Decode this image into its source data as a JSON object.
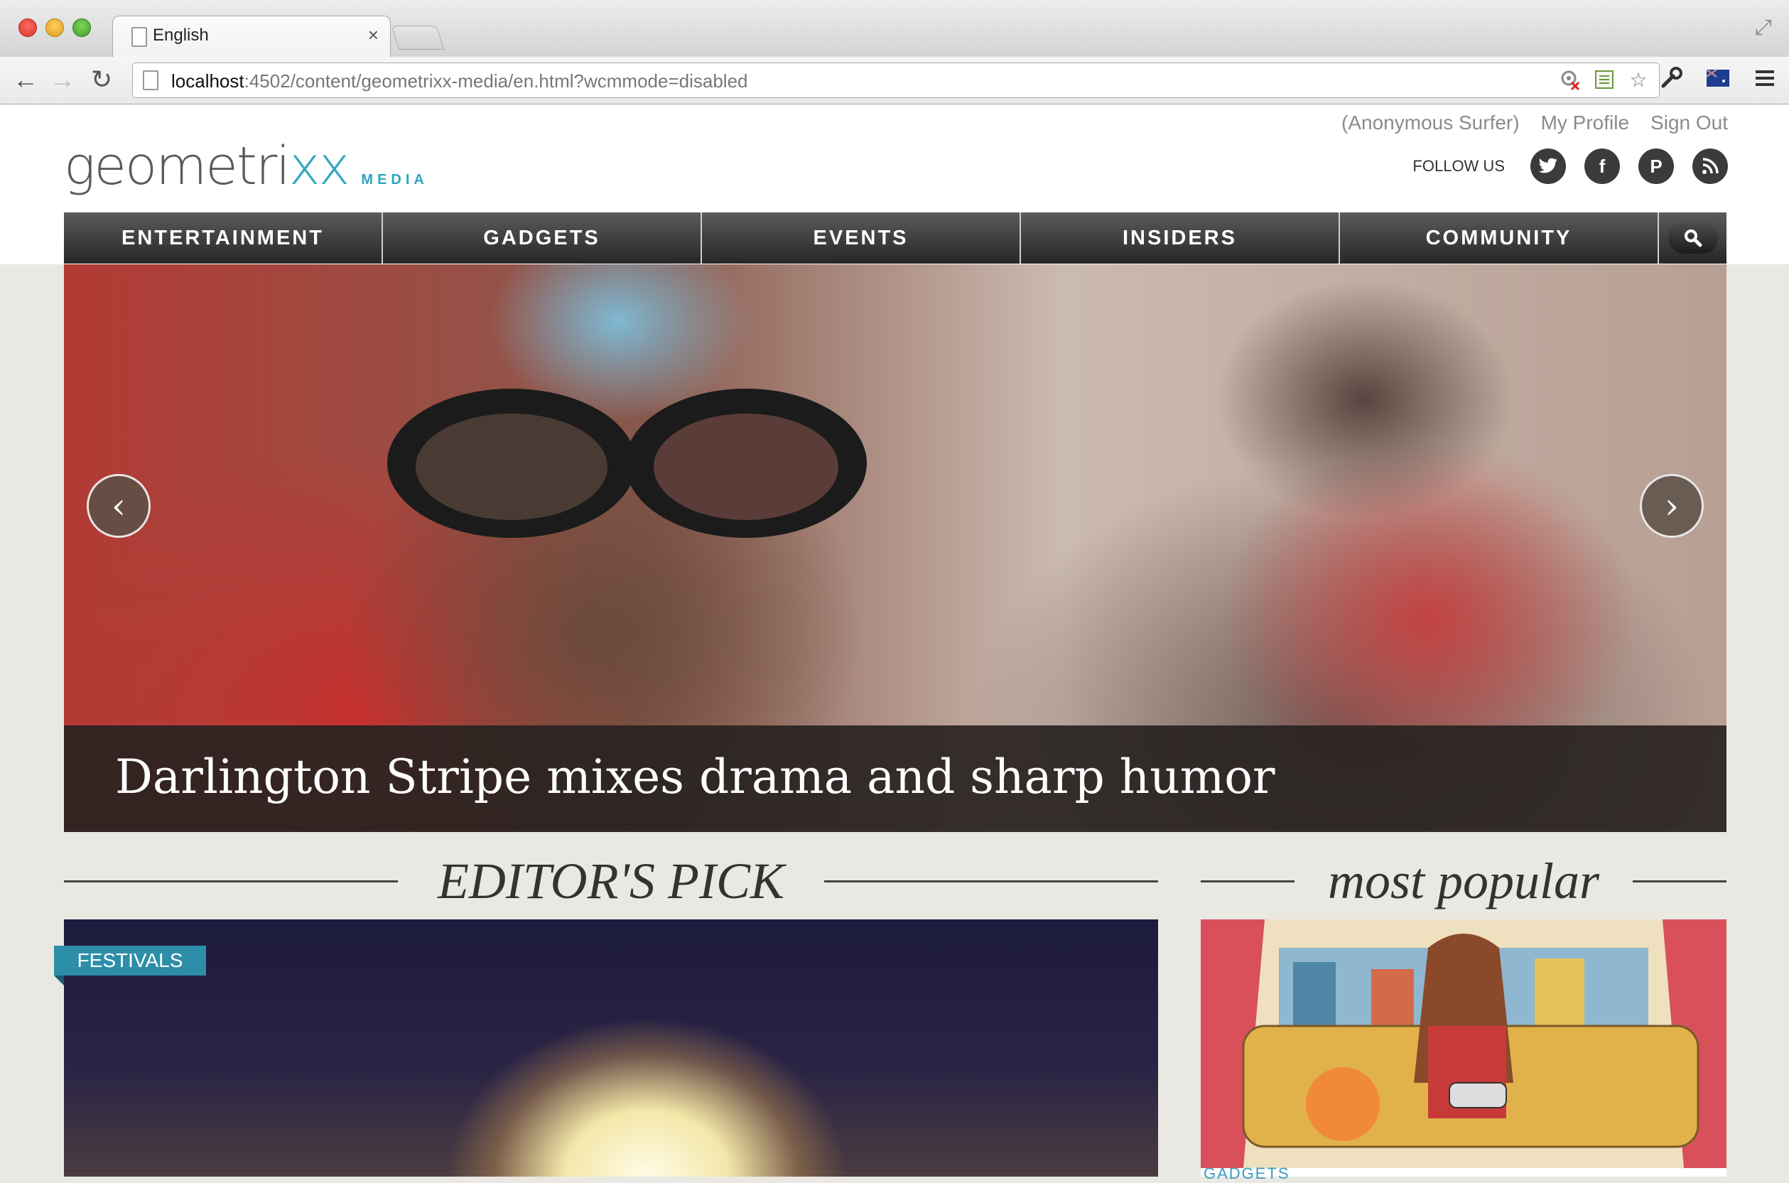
{
  "browser": {
    "tab_title": "English",
    "tab_close": "×",
    "url_host": "localhost",
    "url_rest": ":4502/content/geometrixx-media/en.html?wcmmode=disabled"
  },
  "header": {
    "user_links": [
      "(Anonymous Surfer)",
      "My Profile",
      "Sign Out"
    ],
    "logo_word": "geometri",
    "logo_xx": "xx",
    "logo_sub": "MEDIA",
    "follow_label": "FOLLOW US"
  },
  "nav": {
    "items": [
      "ENTERTAINMENT",
      "GADGETS",
      "EVENTS",
      "INSIDERS",
      "COMMUNITY"
    ]
  },
  "hero": {
    "caption": "Darlington Stripe mixes drama and sharp humor",
    "prev_glyph": "‹",
    "next_glyph": "›"
  },
  "sections": {
    "editors_pick": "EDITOR'S PICK",
    "most_popular": "most popular",
    "editor_badge": "FESTIVALS",
    "popular_tag": "GADGETS"
  },
  "colors": {
    "accent": "#2fa6c2",
    "nav_dark": "#262626",
    "badge": "#2d8ea8",
    "page_bg": "#e9e8e3"
  },
  "icons": {
    "social": [
      "twitter-icon",
      "facebook-icon",
      "pinterest-icon",
      "rss-icon"
    ]
  }
}
